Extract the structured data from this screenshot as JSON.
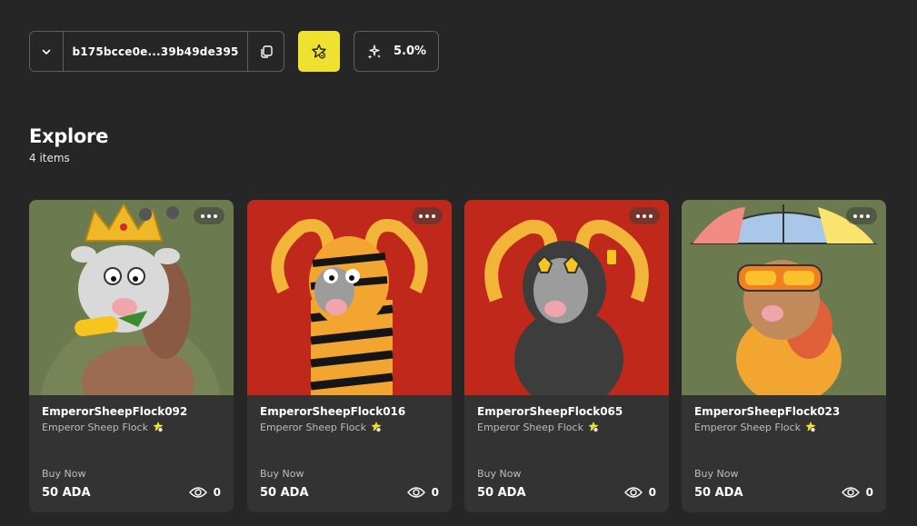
{
  "wallet": {
    "address": "b175bcce0e...39b49de395"
  },
  "royalty": {
    "value": "5.0%"
  },
  "explore": {
    "title": "Explore",
    "count": "4 items"
  },
  "colors": {
    "accent": "#f0e130",
    "background": "#262626",
    "card": "#333333"
  },
  "cards": [
    {
      "name": "EmperorSheepFlock092",
      "collection": "Emperor Sheep Flock",
      "buy": "Buy Now",
      "price": "50 ADA",
      "views": "0"
    },
    {
      "name": "EmperorSheepFlock016",
      "collection": "Emperor Sheep Flock",
      "buy": "Buy Now",
      "price": "50 ADA",
      "views": "0"
    },
    {
      "name": "EmperorSheepFlock065",
      "collection": "Emperor Sheep Flock",
      "buy": "Buy Now",
      "price": "50 ADA",
      "views": "0"
    },
    {
      "name": "EmperorSheepFlock023",
      "collection": "Emperor Sheep Flock",
      "buy": "Buy Now",
      "price": "50 ADA",
      "views": "0"
    }
  ]
}
